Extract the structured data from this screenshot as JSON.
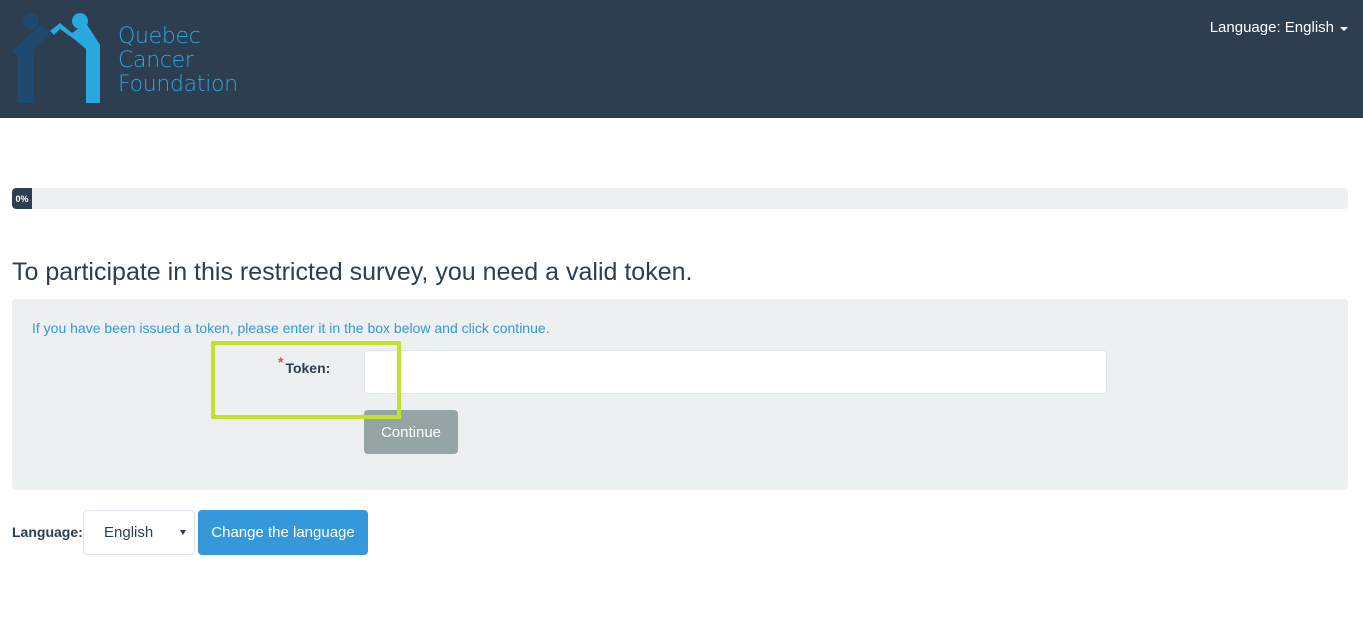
{
  "header": {
    "logo_lines": [
      "Quebec",
      "Cancer",
      "Foundation"
    ],
    "language_menu_label": "Language: English",
    "colors": {
      "background": "#2c3e50",
      "logo_dark": "#1d4a6e",
      "logo_light": "#29a8e0"
    }
  },
  "progress": {
    "value": 0,
    "label": "0%"
  },
  "main": {
    "title": "To participate in this restricted survey, you need a valid token.",
    "info_text": "If you have been issued a token, please enter it in the box below and click continue.",
    "token_required_mark": "*",
    "token_label": "Token:",
    "token_value": "",
    "continue_label": "Continue"
  },
  "language_footer": {
    "label": "Language:",
    "selected": "English",
    "change_button_label": "Change the language"
  },
  "colors": {
    "primary": "#2c3e50",
    "info": "#3498db",
    "muted_button": "#95a5a6",
    "well": "#ecf0f1",
    "required": "#e74c3c",
    "highlight": "#c2e22c"
  }
}
